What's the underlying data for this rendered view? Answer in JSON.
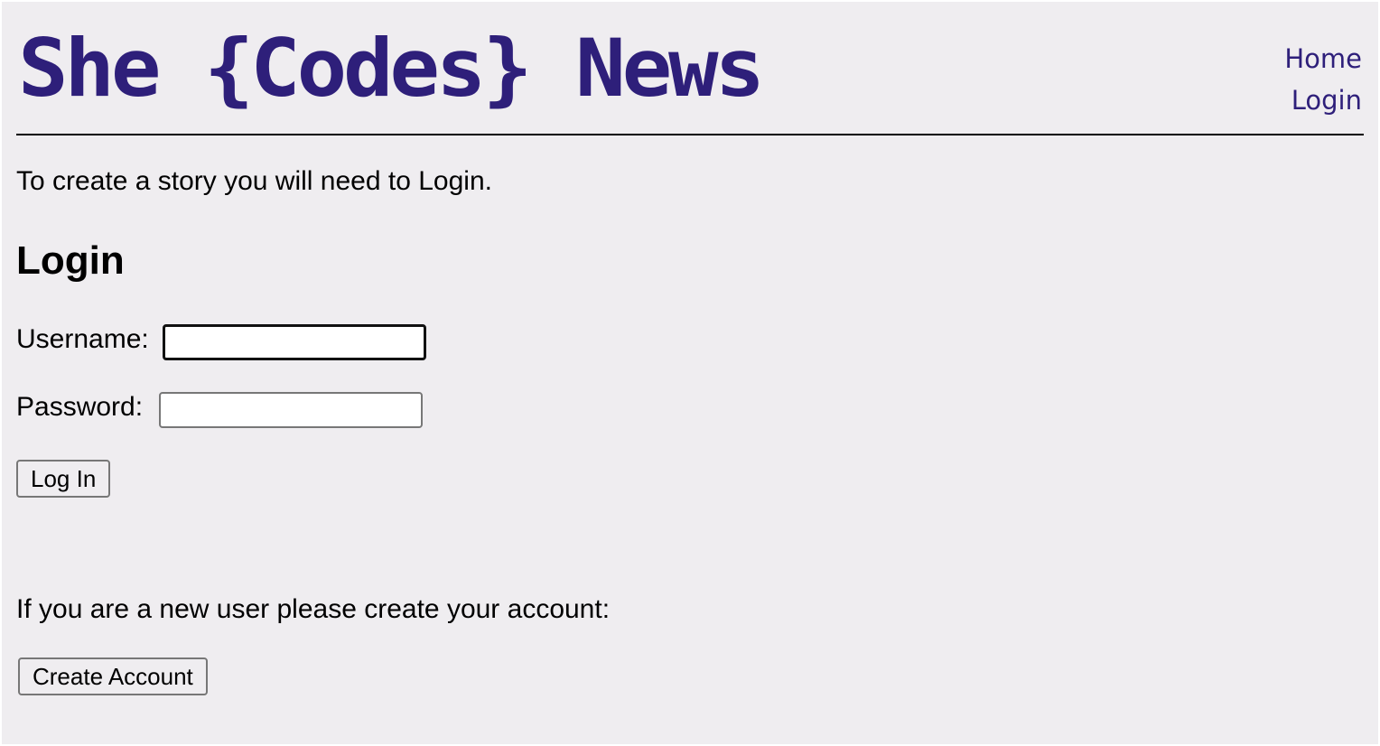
{
  "header": {
    "title": "She {Codes} News",
    "nav": [
      "Home",
      "Login"
    ]
  },
  "intro": "To create a story you will need to Login.",
  "login": {
    "heading": "Login",
    "username_label": "Username:",
    "username_value": "",
    "password_label": "Password:",
    "password_value": "",
    "submit": "Log In"
  },
  "signup": {
    "text": "If you are a new user please create your account:",
    "button": "Create Account"
  },
  "colors": {
    "brand": "#2e1f7a",
    "background": "#efedf0"
  }
}
